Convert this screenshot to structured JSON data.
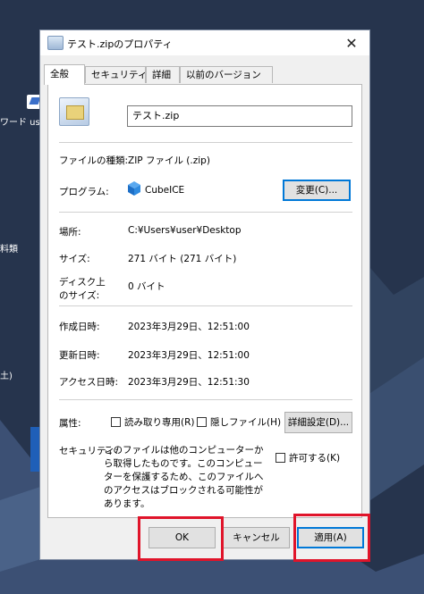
{
  "desktop": {
    "labels": [
      "ワード usb",
      "料類",
      "土)"
    ]
  },
  "dialog": {
    "title": "テスト.zipのプロパティ",
    "close_glyph": "✕",
    "tabs": [
      {
        "label": "全般",
        "active": true
      },
      {
        "label": "セキュリティ",
        "active": false
      },
      {
        "label": "詳細",
        "active": false
      },
      {
        "label": "以前のバージョン",
        "active": false
      }
    ],
    "file_name": "テスト.zip",
    "file_type": {
      "label": "ファイルの種類:",
      "value": "ZIP ファイル (.zip)"
    },
    "program": {
      "label": "プログラム:",
      "value": "CubeICE",
      "change_button": "変更(C)..."
    },
    "location": {
      "label": "場所:",
      "value": "C:¥Users¥user¥Desktop"
    },
    "size": {
      "label": "サイズ:",
      "value": "271 バイト (271 バイト)"
    },
    "disk_size": {
      "label_line1": "ディスク上",
      "label_line2": "のサイズ:",
      "value": "0 バイト"
    },
    "created": {
      "label": "作成日時:",
      "value": "2023年3月29日、12:51:00"
    },
    "modified": {
      "label": "更新日時:",
      "value": "2023年3月29日、12:51:00"
    },
    "accessed": {
      "label": "アクセス日時:",
      "value": "2023年3月29日、12:51:30"
    },
    "attributes": {
      "label": "属性:",
      "readonly": "読み取り専用(R)",
      "hidden": "隠しファイル(H)",
      "advanced_button": "詳細設定(D)..."
    },
    "security": {
      "label": "セキュリティ:",
      "message": "このファイルは他のコンピューターから取得したものです。このコンピューターを保護するため、このファイルへのアクセスはブロックされる可能性があります。",
      "allow": "許可する(K)"
    },
    "buttons": {
      "ok": "OK",
      "cancel": "キャンセル",
      "apply": "適用(A)"
    }
  },
  "colors": {
    "highlight": "#e0142a",
    "focus": "#0078d7",
    "desktop": "#26344d"
  }
}
